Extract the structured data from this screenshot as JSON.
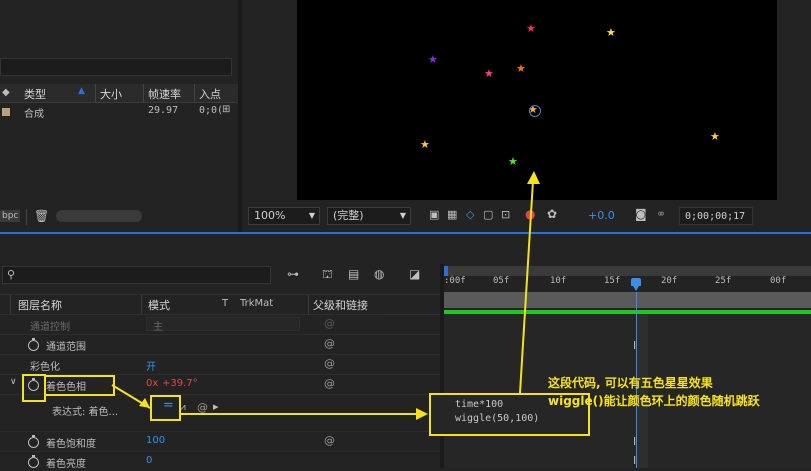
{
  "project": {
    "col_type": "类型",
    "col_size": "大小",
    "col_fps": "帧速率",
    "col_in": "入点",
    "item_type": "合成",
    "item_fps": "29.97",
    "item_in": "0;0(",
    "bpc": "bpc"
  },
  "viewer": {
    "zoom": "100%",
    "resolution": "(完整)",
    "exposure": "+0.0",
    "timecode": "0;00;00;17",
    "stars": [
      {
        "color": "#ff2a55"
      },
      {
        "color": "#ffe233"
      },
      {
        "color": "#8a2be2"
      },
      {
        "color": "#ff3a8a"
      },
      {
        "color": "#ff6a1a"
      },
      {
        "color": "#ffd52a"
      },
      {
        "color": "#ffc72a"
      },
      {
        "color": "#55e033"
      },
      {
        "color": "#ffb01a"
      }
    ]
  },
  "timeline": {
    "col_layer_name": "图层名称",
    "col_mode": "模式",
    "col_t": "T",
    "col_trkmat": "TrkMat",
    "col_parent": "父级和链接",
    "ruler_ticks": [
      ":00f",
      "05f",
      "10f",
      "15f",
      "20f",
      "25f",
      "00f"
    ],
    "rows": [
      {
        "name": "通道控制",
        "value": "主"
      },
      {
        "name": "通道范围",
        "value": ""
      },
      {
        "name": "彩色化",
        "value": "开"
      },
      {
        "name": "着色色相",
        "value_x": "0x",
        "value_deg": "+39.7°"
      },
      {
        "name": "表达式: 着色...",
        "value": ""
      },
      {
        "name": "着色饱和度",
        "value": "100"
      },
      {
        "name": "着色亮度",
        "value": "0"
      }
    ]
  },
  "expression": {
    "line1": "time*100",
    "line2": "wiggle(50,100)"
  },
  "annotation": {
    "line1": "这段代码, 可以有五色星星效果",
    "line2": "wiggle()能让颜色环上的颜色随机跳跃"
  },
  "colors": {
    "accent_blue": "#2d6fd1",
    "annotation_yellow": "#f5e21a",
    "work_area_green": "#1fc91f",
    "value_blue": "#3a8ee6",
    "value_red": "#e04848"
  }
}
